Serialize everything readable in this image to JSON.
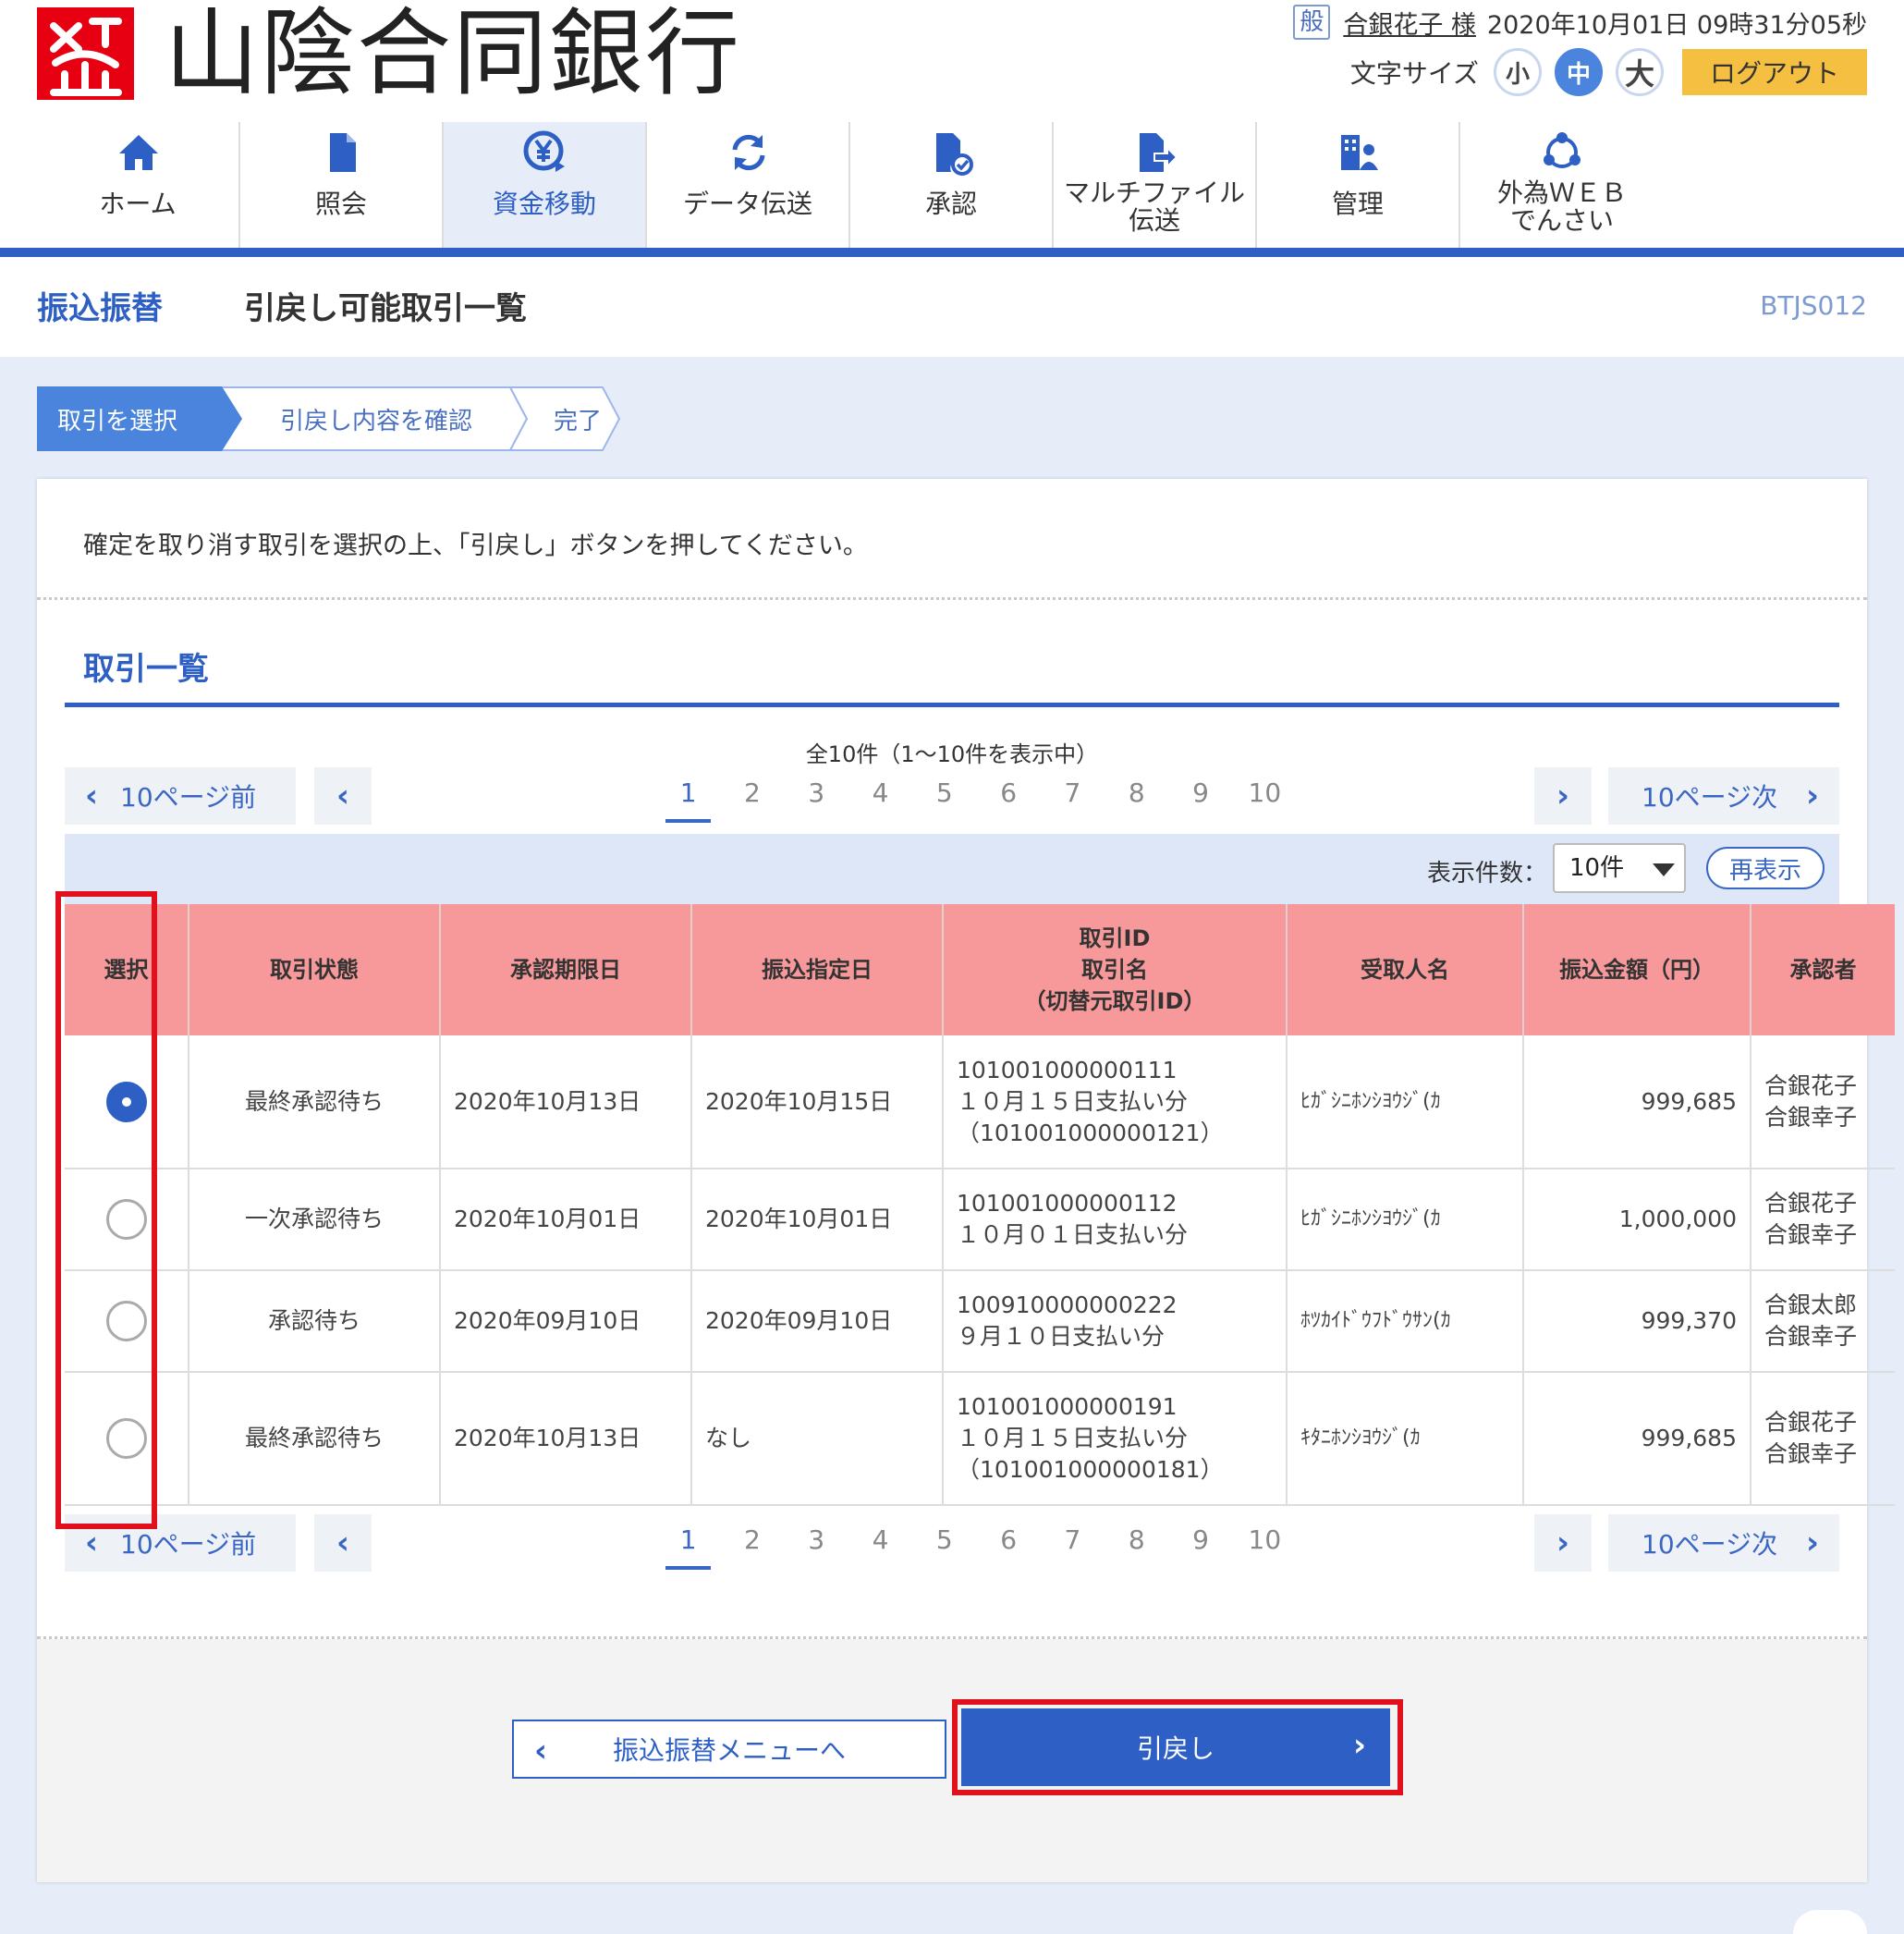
{
  "header": {
    "bank_logo_icon": "sanin-godo-bank-logo",
    "bank_name": "山陰合同銀行",
    "user_kind": "般",
    "user_name": "合銀花子 様",
    "datetime": "2020年10月01日 09時31分05秒",
    "font_size_label": "文字サイズ",
    "font_size_small": "小",
    "font_size_medium": "中",
    "font_size_large": "大",
    "logout_label": "ログアウト"
  },
  "nav": {
    "items": [
      {
        "label": "ホーム",
        "icon": "home-icon"
      },
      {
        "label": "照会",
        "icon": "document-icon"
      },
      {
        "label": "資金移動",
        "icon": "yen-transfer-icon",
        "active": true
      },
      {
        "label": "データ伝送",
        "icon": "refresh-icon"
      },
      {
        "label": "承認",
        "icon": "approve-document-icon"
      },
      {
        "label": "マルチファイル伝送",
        "icon": "file-transfer-icon"
      },
      {
        "label": "管理",
        "icon": "management-icon"
      },
      {
        "label": "外為ＷＥＢでんさい",
        "icon": "network-icon"
      }
    ],
    "item_labels": {
      "home": "ホーム",
      "inquiry": "照会",
      "transfer": "資金移動",
      "data_transmission": "データ伝送",
      "approval": "承認",
      "multifile_line1": "マルチファイル",
      "multifile_line2": "伝送",
      "admin": "管理",
      "fx_line1": "外為ＷＥＢ",
      "fx_line2": "でんさい"
    }
  },
  "page": {
    "section_title": "振込振替",
    "title": "引戻し可能取引一覧",
    "screen_id": "BTJS012"
  },
  "steps": [
    "取引を選択",
    "引戻し内容を確認",
    "完了"
  ],
  "instruction": "確定を取り消す取引を選択の上、「引戻し」ボタンを押してください。",
  "list": {
    "heading": "取引一覧",
    "count_text": "全10件（1～10件を表示中）",
    "pager": {
      "prev10": "10ページ前",
      "next10": "10ページ次",
      "pages": [
        "1",
        "2",
        "3",
        "4",
        "5",
        "6",
        "7",
        "8",
        "9",
        "10"
      ],
      "current": "1"
    },
    "display_count_label": "表示件数：",
    "display_count_value": "10件",
    "redisplay_label": "再表示",
    "columns": {
      "select": "選択",
      "status": "取引状態",
      "approval_deadline": "承認期限日",
      "transfer_date": "振込指定日",
      "tx_id_line1": "取引ID",
      "tx_id_line2": "取引名",
      "tx_id_line3": "（切替元取引ID）",
      "payee": "受取人名",
      "amount": "振込金額（円）",
      "approver": "承認者"
    },
    "rows": [
      {
        "selected": true,
        "status": "最終承認待ち",
        "approval_deadline": "2020年10月13日",
        "transfer_date": "2020年10月15日",
        "tx_id": "101001000000111",
        "tx_name": "１０月１５日支払い分",
        "original_id": "（101001000000121）",
        "payee": "ﾋｶﾞｼﾆﾎﾝｼﾖｳｼﾞ(ｶ",
        "amount": "999,685",
        "approver_1": "合銀花子",
        "approver_2": "合銀幸子"
      },
      {
        "selected": false,
        "status": "一次承認待ち",
        "approval_deadline": "2020年10月01日",
        "transfer_date": "2020年10月01日",
        "tx_id": "101001000000112",
        "tx_name": "１０月０１日支払い分",
        "original_id": "",
        "payee": "ﾋｶﾞｼﾆﾎﾝｼﾖｳｼﾞ(ｶ",
        "amount": "1,000,000",
        "approver_1": "合銀花子",
        "approver_2": "合銀幸子"
      },
      {
        "selected": false,
        "status": "承認待ち",
        "approval_deadline": "2020年09月10日",
        "transfer_date": "2020年09月10日",
        "tx_id": "100910000000222",
        "tx_name": "９月１０日支払い分",
        "original_id": "",
        "payee": "ﾎﾂｶｲﾄﾞｳﾌﾄﾞｳｻﾝ(ｶ",
        "amount": "999,370",
        "approver_1": "合銀太郎",
        "approver_2": "合銀幸子"
      },
      {
        "selected": false,
        "status": "最終承認待ち",
        "approval_deadline": "2020年10月13日",
        "transfer_date": "なし",
        "tx_id": "101001000000191",
        "tx_name": "１０月１５日支払い分",
        "original_id": "（101001000000181）",
        "payee": "ｷﾀﾆﾎﾝｼﾖｳｼﾞ(ｶ",
        "amount": "999,685",
        "approver_1": "合銀花子",
        "approver_2": "合銀幸子"
      }
    ]
  },
  "actions": {
    "back_label": "振込振替メニューへ",
    "withdraw_label": "引戻し"
  },
  "colors": {
    "brand_red": "#e60012",
    "accent_blue": "#2e5fc5",
    "table_header": "#f7999a",
    "highlight_red": "#e0111d",
    "logout_yellow": "#f5c042"
  }
}
